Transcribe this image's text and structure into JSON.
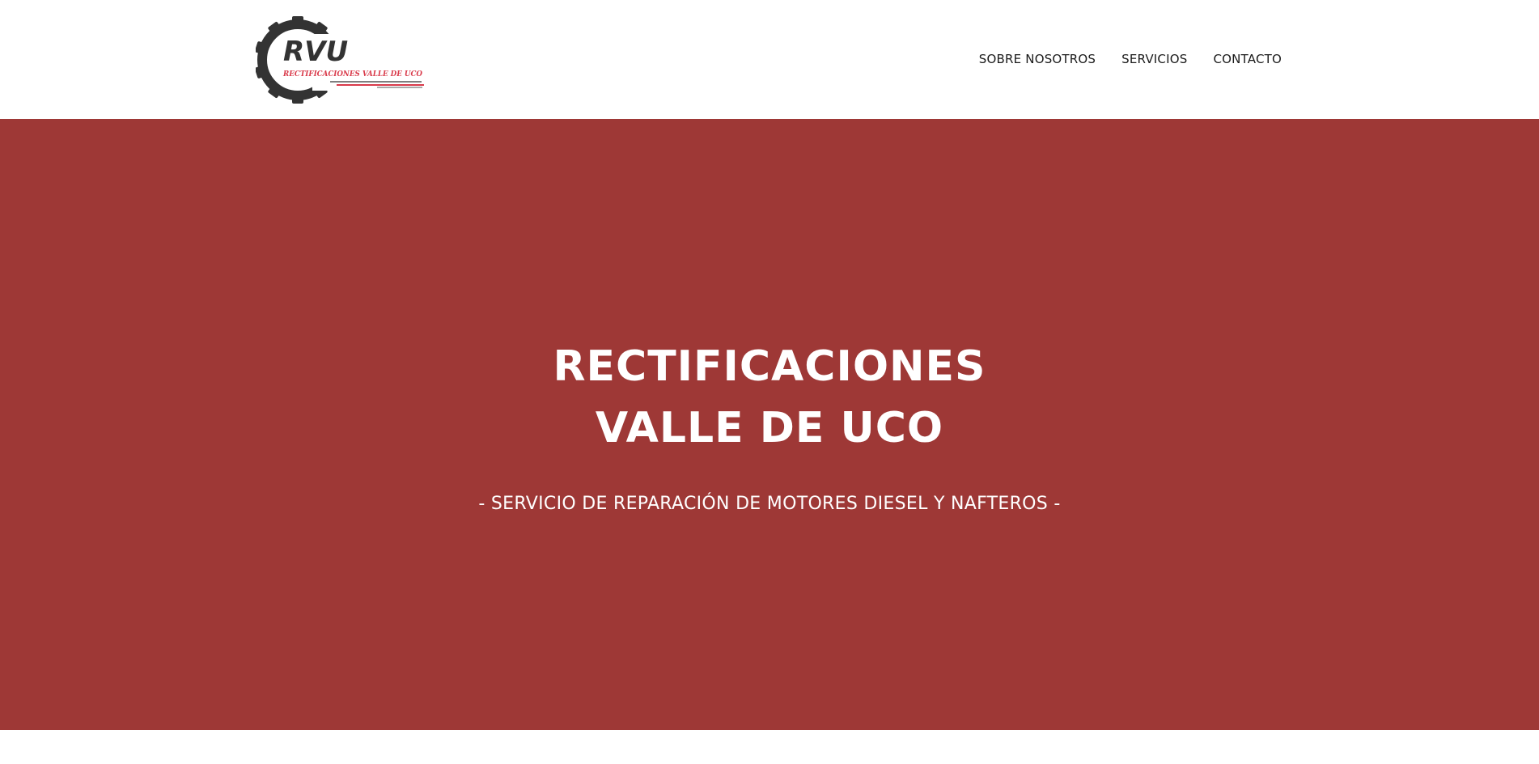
{
  "logo": {
    "mark": "RVU",
    "tagline": "RECTIFICACIONES VALLE DE UCO",
    "icon": "gear-icon"
  },
  "nav": {
    "items": [
      {
        "label": "SOBRE NOSOTROS"
      },
      {
        "label": "SERVICIOS"
      },
      {
        "label": "CONTACTO"
      }
    ]
  },
  "hero": {
    "title_line1": "RECTIFICACIONES",
    "title_line2": "VALLE DE UCO",
    "subtitle": "- SERVICIO DE REPARACIÓN DE MOTORES DIESEL Y NAFTEROS -"
  },
  "colors": {
    "hero_background": "#9e3836",
    "logo_dark": "#333333",
    "logo_accent": "#d93a4a"
  }
}
